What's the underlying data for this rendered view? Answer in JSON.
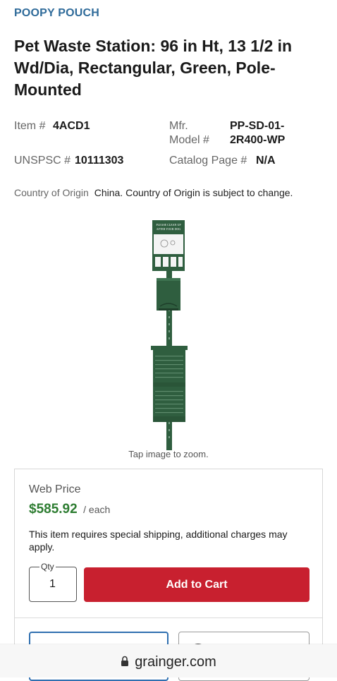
{
  "brand": "POOPY POUCH",
  "product": {
    "title": "Pet Waste Station: 96 in Ht, 13 1/2 in Wd/Dia, Rectangular, Green, Pole-Mounted"
  },
  "specs": {
    "item_label": "Item #",
    "item_value": "4ACD1",
    "mfr_label_1": "Mfr.",
    "mfr_label_2": "Model #",
    "mfr_value_1": "PP-SD-01-",
    "mfr_value_2": "2R400-WP",
    "unspsc_label": "UNSPSC #",
    "unspsc_value": "10111303",
    "catalog_label": "Catalog Page #",
    "catalog_value": "N/A"
  },
  "origin": {
    "label": "Country of Origin",
    "value": "China. Country of Origin is subject to change."
  },
  "image": {
    "sign_line_1": "PLEASE CLEAN UP",
    "sign_line_2": "AFTER YOUR DOG",
    "colors": {
      "pole": "#2f5e3f",
      "sign_white": "#f4f4f4"
    }
  },
  "zoom_hint": "Tap image to zoom.",
  "buy": {
    "web_price_label": "Web Price",
    "price": "$585.92",
    "unit": "/ each",
    "shipping_note": "This item requires special shipping, additional charges may apply.",
    "qty_label": "Qty",
    "qty_value": "1",
    "add_to_cart": "Add to Cart"
  },
  "browser": {
    "url": "grainger.com"
  },
  "colors": {
    "brand": "#2f6b9a",
    "price": "#2e7d32",
    "cart_button": "#c8202f"
  }
}
